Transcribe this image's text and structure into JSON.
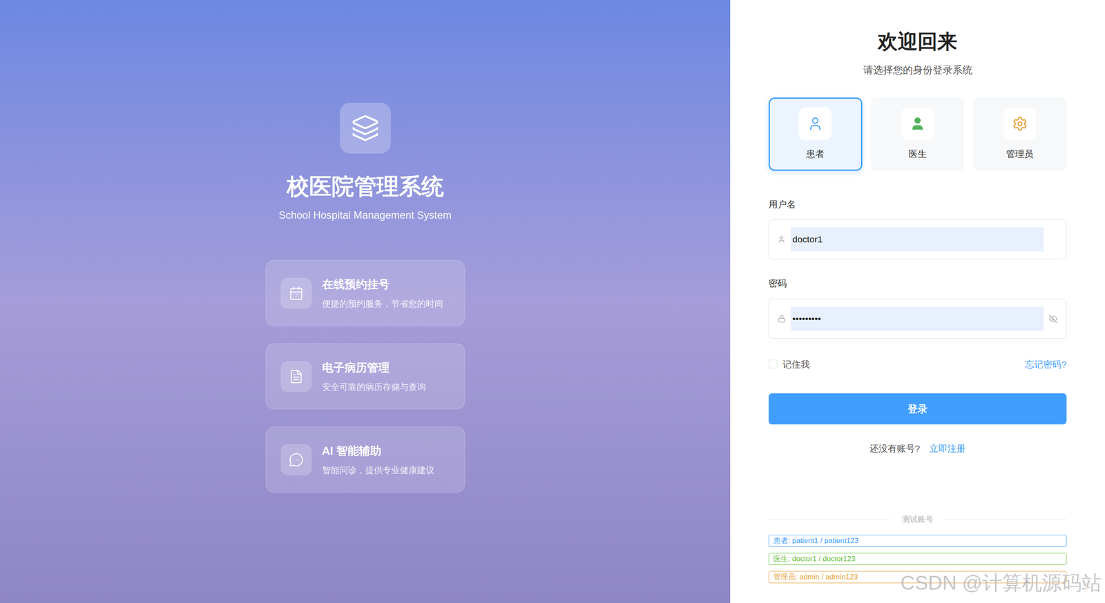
{
  "brand": {
    "title": "校医院管理系统",
    "subtitle": "School Hospital Management System"
  },
  "features": [
    {
      "kind": "calendar",
      "title": "在线预约挂号",
      "desc": "便捷的预约服务，节省您的时间"
    },
    {
      "kind": "document",
      "title": "电子病历管理",
      "desc": "安全可靠的病历存储与查询"
    },
    {
      "kind": "chat",
      "title": "AI 智能辅助",
      "desc": "智能问诊，提供专业健康建议"
    }
  ],
  "login": {
    "heading": "欢迎回来",
    "subheading": "请选择您的身份登录系统"
  },
  "roles": [
    {
      "kind": "patient",
      "label": "患者",
      "selected": true,
      "color": "#409eff"
    },
    {
      "kind": "doctor",
      "label": "医生",
      "selected": false,
      "color": "#52b35a"
    },
    {
      "kind": "admin",
      "label": "管理员",
      "selected": false,
      "color": "#e6a23c"
    }
  ],
  "fields": [
    {
      "kind": "username",
      "label": "用户名",
      "value": "doctor1"
    },
    {
      "kind": "password",
      "label": "密码",
      "value": "•••••••••"
    }
  ],
  "remember": {
    "label": "记住我",
    "checked": false
  },
  "forgot": "忘记密码?",
  "submit": "登录",
  "register": {
    "prompt": "还没有账号?",
    "link": "立即注册"
  },
  "test_accounts": {
    "title": "测试账号",
    "items": [
      {
        "text": "患者: patient1 / patient123",
        "color": "#409eff"
      },
      {
        "text": "医生: doctor1 / doctor123",
        "color": "#67c23a"
      },
      {
        "text": "管理员: admin / admin123",
        "color": "#e6a23c"
      }
    ]
  },
  "watermark": "CSDN @计算机源码站"
}
